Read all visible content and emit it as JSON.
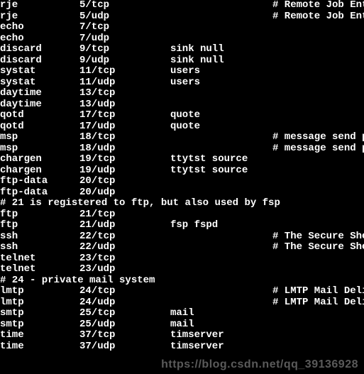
{
  "rows": [
    {
      "type": "svc",
      "service": "rje",
      "port": "5/tcp",
      "alias": "",
      "comment": "# Remote Job Entr"
    },
    {
      "type": "svc",
      "service": "rje",
      "port": "5/udp",
      "alias": "",
      "comment": "# Remote Job Entr"
    },
    {
      "type": "svc",
      "service": "echo",
      "port": "7/tcp",
      "alias": "",
      "comment": ""
    },
    {
      "type": "svc",
      "service": "echo",
      "port": "7/udp",
      "alias": "",
      "comment": ""
    },
    {
      "type": "svc",
      "service": "discard",
      "port": "9/tcp",
      "alias": "sink null",
      "comment": ""
    },
    {
      "type": "svc",
      "service": "discard",
      "port": "9/udp",
      "alias": "sink null",
      "comment": ""
    },
    {
      "type": "svc",
      "service": "systat",
      "port": "11/tcp",
      "alias": "users",
      "comment": ""
    },
    {
      "type": "svc",
      "service": "systat",
      "port": "11/udp",
      "alias": "users",
      "comment": ""
    },
    {
      "type": "svc",
      "service": "daytime",
      "port": "13/tcp",
      "alias": "",
      "comment": ""
    },
    {
      "type": "svc",
      "service": "daytime",
      "port": "13/udp",
      "alias": "",
      "comment": ""
    },
    {
      "type": "svc",
      "service": "qotd",
      "port": "17/tcp",
      "alias": "quote",
      "comment": ""
    },
    {
      "type": "svc",
      "service": "qotd",
      "port": "17/udp",
      "alias": "quote",
      "comment": ""
    },
    {
      "type": "svc",
      "service": "msp",
      "port": "18/tcp",
      "alias": "",
      "comment": "# message send pr"
    },
    {
      "type": "svc",
      "service": "msp",
      "port": "18/udp",
      "alias": "",
      "comment": "# message send pr"
    },
    {
      "type": "svc",
      "service": "chargen",
      "port": "19/tcp",
      "alias": "ttytst source",
      "comment": ""
    },
    {
      "type": "svc",
      "service": "chargen",
      "port": "19/udp",
      "alias": "ttytst source",
      "comment": ""
    },
    {
      "type": "svc",
      "service": "ftp-data",
      "port": "20/tcp",
      "alias": "",
      "comment": ""
    },
    {
      "type": "svc",
      "service": "ftp-data",
      "port": "20/udp",
      "alias": "",
      "comment": ""
    },
    {
      "type": "comment",
      "text": "# 21 is registered to ftp, but also used by fsp"
    },
    {
      "type": "svc",
      "service": "ftp",
      "port": "21/tcp",
      "alias": "",
      "comment": ""
    },
    {
      "type": "svc",
      "service": "ftp",
      "port": "21/udp",
      "alias": "fsp fspd",
      "comment": ""
    },
    {
      "type": "svc",
      "service": "ssh",
      "port": "22/tcp",
      "alias": "",
      "comment": "# The Secure Shel"
    },
    {
      "type": "svc",
      "service": "ssh",
      "port": "22/udp",
      "alias": "",
      "comment": "# The Secure Shel"
    },
    {
      "type": "svc",
      "service": "telnet",
      "port": "23/tcp",
      "alias": "",
      "comment": ""
    },
    {
      "type": "svc",
      "service": "telnet",
      "port": "23/udp",
      "alias": "",
      "comment": ""
    },
    {
      "type": "comment",
      "text": "# 24 - private mail system"
    },
    {
      "type": "svc",
      "service": "lmtp",
      "port": "24/tcp",
      "alias": "",
      "comment": "# LMTP Mail Deliv"
    },
    {
      "type": "svc",
      "service": "lmtp",
      "port": "24/udp",
      "alias": "",
      "comment": "# LMTP Mail Deliv"
    },
    {
      "type": "svc",
      "service": "smtp",
      "port": "25/tcp",
      "alias": "mail",
      "comment": ""
    },
    {
      "type": "svc",
      "service": "smtp",
      "port": "25/udp",
      "alias": "mail",
      "comment": ""
    },
    {
      "type": "svc",
      "service": "time",
      "port": "37/tcp",
      "alias": "timserver",
      "comment": ""
    },
    {
      "type": "svc",
      "service": "time",
      "port": "37/udp",
      "alias": "timserver",
      "comment": ""
    }
  ],
  "watermark": "https://blog.csdn.net/qq_39136928"
}
